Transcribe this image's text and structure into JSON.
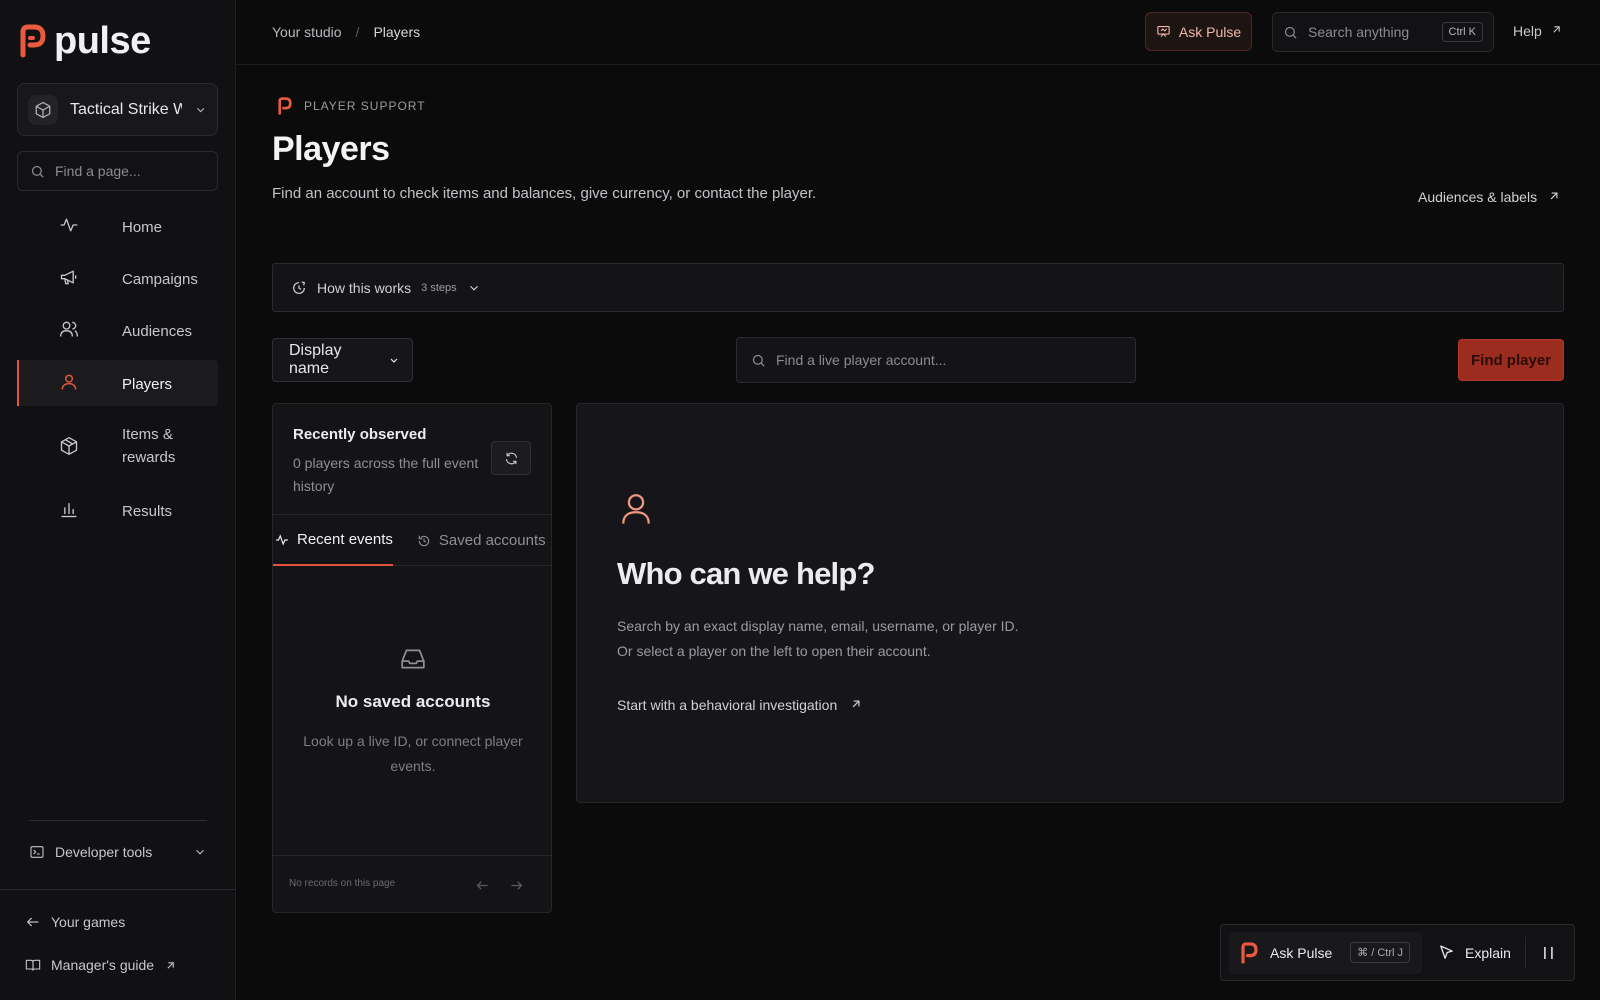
{
  "brand": {
    "name": "pulse"
  },
  "workspace": {
    "name": "Tactical Strike W"
  },
  "sidebar": {
    "search_placeholder": "Find a page...",
    "items": [
      {
        "label": "Home",
        "icon": "activity-icon"
      },
      {
        "label": "Campaigns",
        "icon": "megaphone-icon"
      },
      {
        "label": "Audiences",
        "icon": "users-icon"
      },
      {
        "label": "Players",
        "icon": "user-icon",
        "active": true
      },
      {
        "label": "Items & rewards",
        "icon": "box-icon"
      },
      {
        "label": "Results",
        "icon": "bar-chart-icon"
      }
    ],
    "developer_tools": "Developer tools",
    "your_games": "Your games",
    "managers_guide": "Manager's guide"
  },
  "header": {
    "breadcrumb": [
      "Your studio",
      "/",
      "Players"
    ],
    "ask_label": "Ask Pulse",
    "search_placeholder": "Search anything",
    "search_shortcut": "Ctrl K",
    "help_label": "Help"
  },
  "main": {
    "eyebrow": "PLAYER SUPPORT",
    "title": "Players",
    "description": "Find an account to check items and balances, give currency, or contact the player.",
    "audiences_link": "Audiences & labels",
    "how_it_works": {
      "label": "How this works",
      "steps": "3 steps"
    },
    "search_by": {
      "selected": "Display name"
    },
    "player_search_placeholder": "Find a live player account...",
    "find_button": "Find player"
  },
  "left_panel": {
    "title": "Recently observed",
    "subtitle": "0 players across the full event history",
    "tabs": [
      "Recent events",
      "Saved accounts"
    ],
    "empty_title": "No saved accounts",
    "empty_desc": "Look up a live ID, or connect player events.",
    "footer": "No records on this page"
  },
  "right_panel": {
    "title": "Who can we help?",
    "description": "Search by an exact display name, email, username, or player ID. Or select a player on the left to open their account.",
    "link": "Start with a behavioral investigation"
  },
  "dock": {
    "ask_label": "Ask Pulse",
    "shortcut": "⌘ / Ctrl J",
    "explain_label": "Explain"
  },
  "colors": {
    "accent": "#e2553a",
    "background": "#0b0b0c",
    "panel": "#141417"
  }
}
